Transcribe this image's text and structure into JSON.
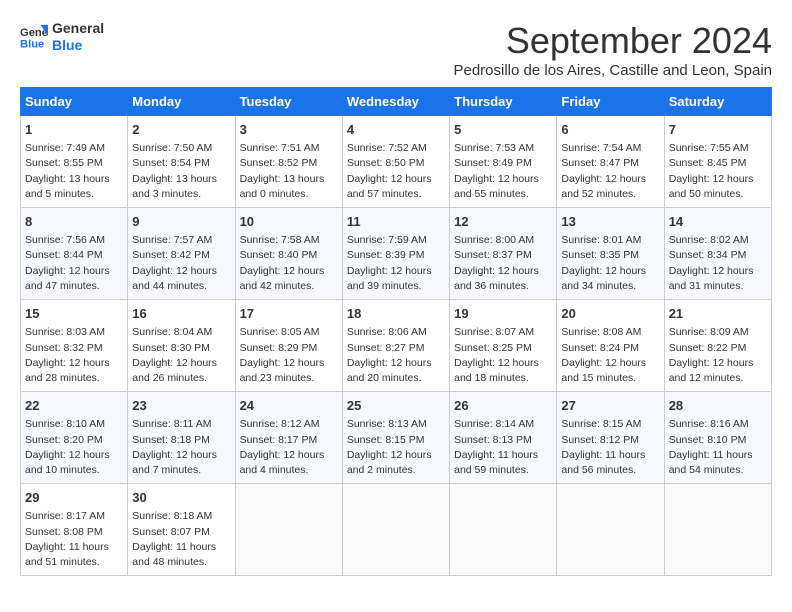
{
  "logo": {
    "line1": "General",
    "line2": "Blue"
  },
  "title": "September 2024",
  "subtitle": "Pedrosillo de los Aires, Castille and Leon, Spain",
  "days_of_week": [
    "Sunday",
    "Monday",
    "Tuesday",
    "Wednesday",
    "Thursday",
    "Friday",
    "Saturday"
  ],
  "weeks": [
    [
      {
        "day": "1",
        "info": "Sunrise: 7:49 AM\nSunset: 8:55 PM\nDaylight: 13 hours and 5 minutes."
      },
      {
        "day": "2",
        "info": "Sunrise: 7:50 AM\nSunset: 8:54 PM\nDaylight: 13 hours and 3 minutes."
      },
      {
        "day": "3",
        "info": "Sunrise: 7:51 AM\nSunset: 8:52 PM\nDaylight: 13 hours and 0 minutes."
      },
      {
        "day": "4",
        "info": "Sunrise: 7:52 AM\nSunset: 8:50 PM\nDaylight: 12 hours and 57 minutes."
      },
      {
        "day": "5",
        "info": "Sunrise: 7:53 AM\nSunset: 8:49 PM\nDaylight: 12 hours and 55 minutes."
      },
      {
        "day": "6",
        "info": "Sunrise: 7:54 AM\nSunset: 8:47 PM\nDaylight: 12 hours and 52 minutes."
      },
      {
        "day": "7",
        "info": "Sunrise: 7:55 AM\nSunset: 8:45 PM\nDaylight: 12 hours and 50 minutes."
      }
    ],
    [
      {
        "day": "8",
        "info": "Sunrise: 7:56 AM\nSunset: 8:44 PM\nDaylight: 12 hours and 47 minutes."
      },
      {
        "day": "9",
        "info": "Sunrise: 7:57 AM\nSunset: 8:42 PM\nDaylight: 12 hours and 44 minutes."
      },
      {
        "day": "10",
        "info": "Sunrise: 7:58 AM\nSunset: 8:40 PM\nDaylight: 12 hours and 42 minutes."
      },
      {
        "day": "11",
        "info": "Sunrise: 7:59 AM\nSunset: 8:39 PM\nDaylight: 12 hours and 39 minutes."
      },
      {
        "day": "12",
        "info": "Sunrise: 8:00 AM\nSunset: 8:37 PM\nDaylight: 12 hours and 36 minutes."
      },
      {
        "day": "13",
        "info": "Sunrise: 8:01 AM\nSunset: 8:35 PM\nDaylight: 12 hours and 34 minutes."
      },
      {
        "day": "14",
        "info": "Sunrise: 8:02 AM\nSunset: 8:34 PM\nDaylight: 12 hours and 31 minutes."
      }
    ],
    [
      {
        "day": "15",
        "info": "Sunrise: 8:03 AM\nSunset: 8:32 PM\nDaylight: 12 hours and 28 minutes."
      },
      {
        "day": "16",
        "info": "Sunrise: 8:04 AM\nSunset: 8:30 PM\nDaylight: 12 hours and 26 minutes."
      },
      {
        "day": "17",
        "info": "Sunrise: 8:05 AM\nSunset: 8:29 PM\nDaylight: 12 hours and 23 minutes."
      },
      {
        "day": "18",
        "info": "Sunrise: 8:06 AM\nSunset: 8:27 PM\nDaylight: 12 hours and 20 minutes."
      },
      {
        "day": "19",
        "info": "Sunrise: 8:07 AM\nSunset: 8:25 PM\nDaylight: 12 hours and 18 minutes."
      },
      {
        "day": "20",
        "info": "Sunrise: 8:08 AM\nSunset: 8:24 PM\nDaylight: 12 hours and 15 minutes."
      },
      {
        "day": "21",
        "info": "Sunrise: 8:09 AM\nSunset: 8:22 PM\nDaylight: 12 hours and 12 minutes."
      }
    ],
    [
      {
        "day": "22",
        "info": "Sunrise: 8:10 AM\nSunset: 8:20 PM\nDaylight: 12 hours and 10 minutes."
      },
      {
        "day": "23",
        "info": "Sunrise: 8:11 AM\nSunset: 8:18 PM\nDaylight: 12 hours and 7 minutes."
      },
      {
        "day": "24",
        "info": "Sunrise: 8:12 AM\nSunset: 8:17 PM\nDaylight: 12 hours and 4 minutes."
      },
      {
        "day": "25",
        "info": "Sunrise: 8:13 AM\nSunset: 8:15 PM\nDaylight: 12 hours and 2 minutes."
      },
      {
        "day": "26",
        "info": "Sunrise: 8:14 AM\nSunset: 8:13 PM\nDaylight: 11 hours and 59 minutes."
      },
      {
        "day": "27",
        "info": "Sunrise: 8:15 AM\nSunset: 8:12 PM\nDaylight: 11 hours and 56 minutes."
      },
      {
        "day": "28",
        "info": "Sunrise: 8:16 AM\nSunset: 8:10 PM\nDaylight: 11 hours and 54 minutes."
      }
    ],
    [
      {
        "day": "29",
        "info": "Sunrise: 8:17 AM\nSunset: 8:08 PM\nDaylight: 11 hours and 51 minutes."
      },
      {
        "day": "30",
        "info": "Sunrise: 8:18 AM\nSunset: 8:07 PM\nDaylight: 11 hours and 48 minutes."
      },
      {
        "day": "",
        "info": ""
      },
      {
        "day": "",
        "info": ""
      },
      {
        "day": "",
        "info": ""
      },
      {
        "day": "",
        "info": ""
      },
      {
        "day": "",
        "info": ""
      }
    ]
  ]
}
